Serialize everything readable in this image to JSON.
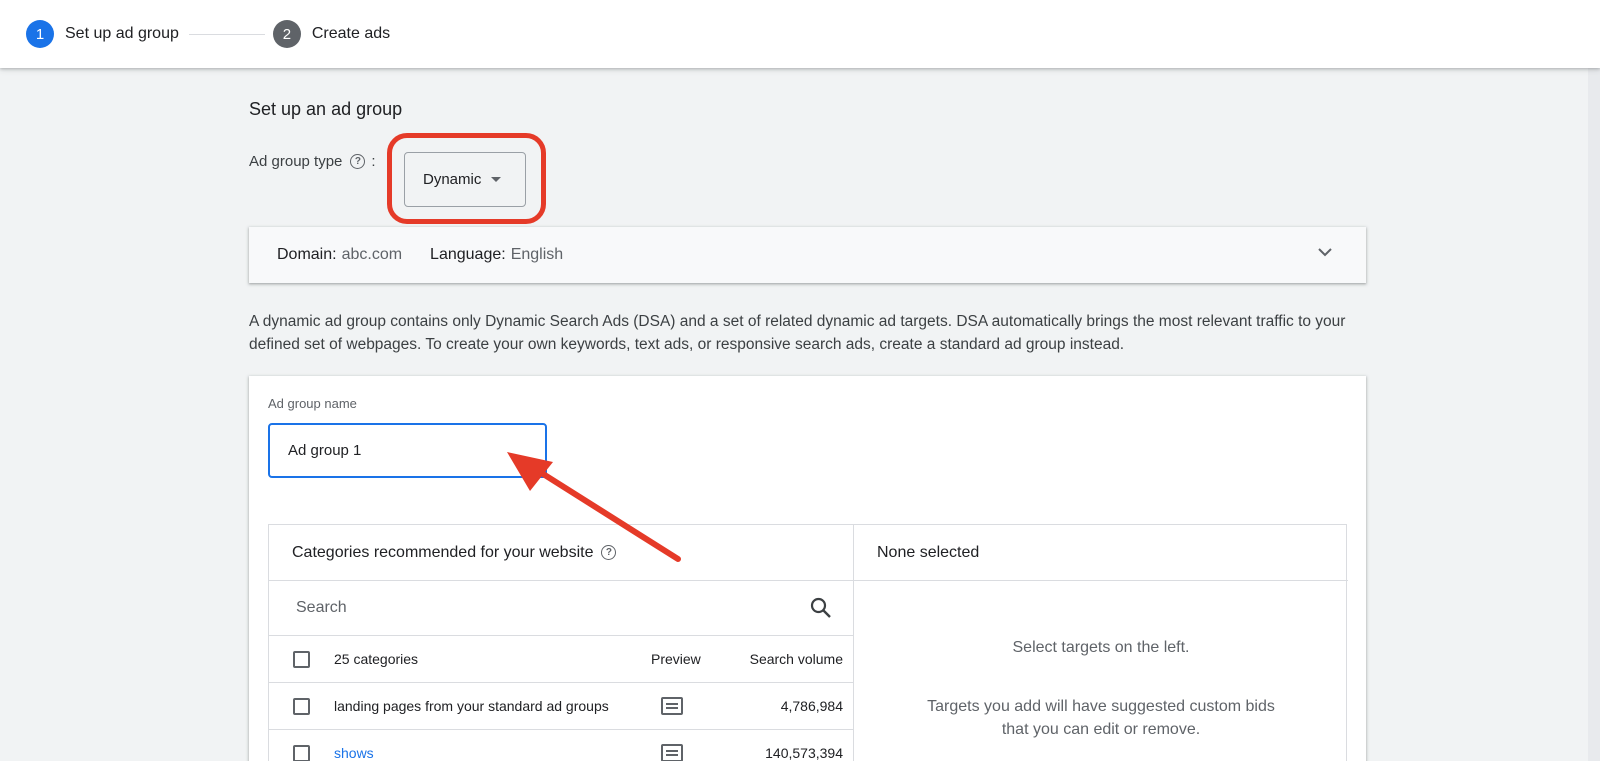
{
  "stepper": {
    "steps": [
      {
        "number": "1",
        "label": "Set up ad group",
        "state": "active"
      },
      {
        "number": "2",
        "label": "Create ads",
        "state": "inactive"
      }
    ]
  },
  "section_title": "Set up an ad group",
  "ad_group_type": {
    "label": "Ad group type",
    "help_icon": "?",
    "colon": ":",
    "selected": "Dynamic"
  },
  "domain_panel": {
    "domain_key": "Domain:",
    "domain_value": "abc.com",
    "language_key": "Language:",
    "language_value": "English"
  },
  "description": "A dynamic ad group contains only Dynamic Search Ads (DSA) and a set of related dynamic ad targets. DSA automatically brings the most relevant traffic to your defined set of webpages. To create your own keywords, text ads, or responsive search ads, create a standard ad group instead.",
  "ad_group_name": {
    "label": "Ad group name",
    "value": "Ad group 1"
  },
  "categories": {
    "header": "Categories recommended for your website",
    "help_icon": "?",
    "search_placeholder": "Search",
    "count_label": "25 categories",
    "col_preview": "Preview",
    "col_volume": "Search volume",
    "rows": [
      {
        "name": "landing pages from your standard ad groups",
        "volume": "4,786,984",
        "link": false
      },
      {
        "name": "shows",
        "volume": "140,573,394",
        "link": true
      }
    ]
  },
  "selection": {
    "header": "None selected",
    "empty_line1": "Select targets on the left.",
    "empty_line2": "Targets you add will have suggested custom bids that you can edit or remove."
  },
  "colors": {
    "accent": "#1a73e8",
    "annotation": "#e53a28",
    "background": "#f1f3f4"
  }
}
